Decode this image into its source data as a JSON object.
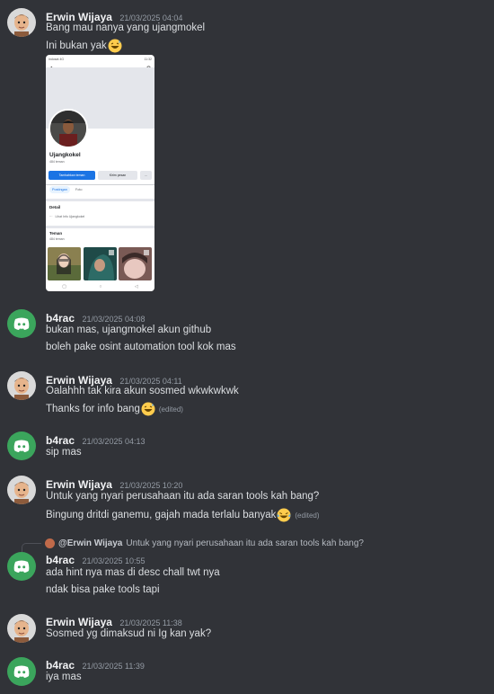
{
  "messages": [
    {
      "user": "Erwin Wijaya",
      "time": "21/03/2025 04:04",
      "lines": [
        "Bang mau nanya yang ujangmokel",
        "Ini bukan yak"
      ]
    },
    {
      "user": "b4rac",
      "time": "21/03/2025 04:08",
      "lines": [
        "bukan mas, ujangmokel akun github",
        "boleh pake osint automation tool kok mas"
      ]
    },
    {
      "user": "Erwin Wijaya",
      "time": "21/03/2025 04:11",
      "lines": [
        "Oalahhh tak kira akun sosmed wkwkwkwk",
        "Thanks for info bang"
      ]
    },
    {
      "user": "b4rac",
      "time": "21/03/2025 04:13",
      "lines": [
        "sip mas"
      ]
    },
    {
      "user": "Erwin Wijaya",
      "time": "21/03/2025 10:20",
      "lines": [
        "Untuk yang nyari perusahaan itu ada saran tools kah bang?",
        "Bingung dritdi ganemu, gajah mada terlalu banyak"
      ]
    },
    {
      "user": "b4rac",
      "time": "21/03/2025 10:55",
      "lines": [
        "ada hint nya mas di desc chall twt nya",
        "ndak bisa pake tools tapi"
      ]
    },
    {
      "user": "Erwin Wijaya",
      "time": "21/03/2025 11:38",
      "lines": [
        "Sosmed yg dimaksud ni Ig kan yak?"
      ]
    },
    {
      "user": "b4rac",
      "time": "21/03/2025 11:39",
      "lines": [
        "iya mas"
      ]
    }
  ],
  "edited_label": "(edited)",
  "reply": {
    "name": "@Erwin Wijaya",
    "text": "Untuk yang nyari perusahaan itu ada saran tools kah bang?"
  },
  "phone": {
    "status_left": "Indosat 4G",
    "status_right": "11:32",
    "profile_name": "Ujangkokel",
    "friend_count": "484 teman",
    "add_friend": "Tambahkan teman",
    "message": "Kirim pesan",
    "more": "...",
    "tab_posts": "Postingan",
    "tab_photos": "Foto",
    "details_heading": "Detail",
    "details_info": "Lihat Info Ujangkokel",
    "friends_heading": "Teman",
    "friends_count": "484 teman"
  },
  "colors": {
    "background": "#313338",
    "username": "#f2f3f5",
    "timestamp": "#949ba4",
    "text": "#dbdee1",
    "discord_blurple": "#5865f2",
    "discord_green": "#3ba55c"
  }
}
